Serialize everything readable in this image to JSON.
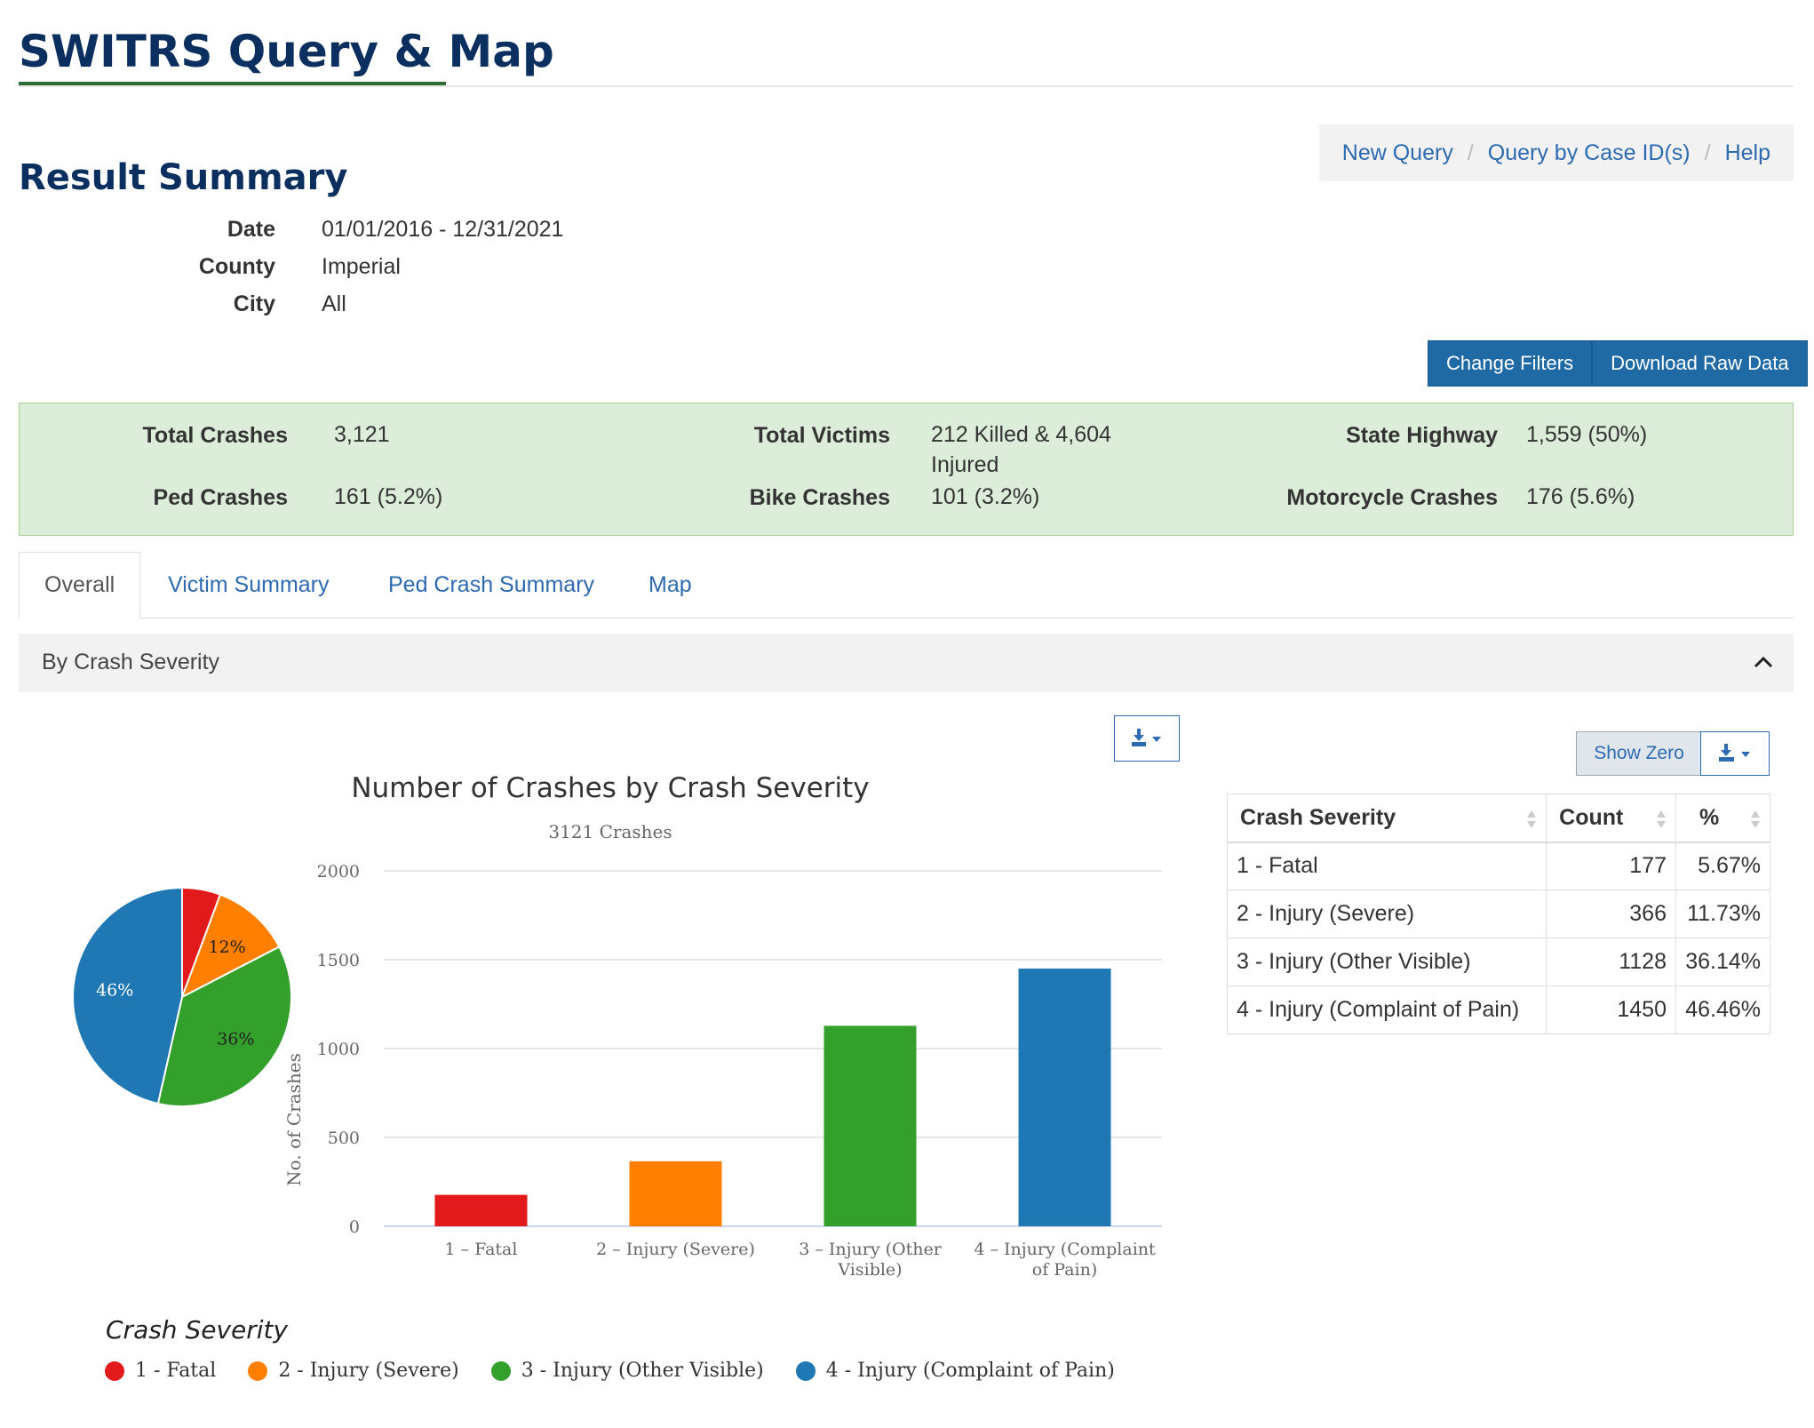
{
  "app": {
    "title": "SWITRS Query & Map"
  },
  "nav": {
    "links": [
      "New Query",
      "Query by Case ID(s)",
      "Help"
    ]
  },
  "result": {
    "title": "Result Summary",
    "filters": [
      {
        "label": "Date",
        "value": "01/01/2016 - 12/31/2021"
      },
      {
        "label": "County",
        "value": "Imperial"
      },
      {
        "label": "City",
        "value": "All"
      }
    ]
  },
  "buttons": {
    "change_filters": "Change Filters",
    "download_raw": "Download Raw Data"
  },
  "summary": {
    "total_crashes_label": "Total Crashes",
    "total_crashes_value": "3,121",
    "ped_crashes_label": "Ped Crashes",
    "ped_crashes_value": "161 (5.2%)",
    "total_victims_label": "Total Victims",
    "total_victims_value": "212 Killed & 4,604 Injured",
    "bike_crashes_label": "Bike Crashes",
    "bike_crashes_value": "101 (3.2%)",
    "state_highway_label": "State Highway",
    "state_highway_value": "1,559 (50%)",
    "motorcycle_label": "Motorcycle Crashes",
    "motorcycle_value": "176 (5.6%)"
  },
  "tabs": [
    {
      "label": "Overall",
      "active": true
    },
    {
      "label": "Victim Summary",
      "active": false
    },
    {
      "label": "Ped Crash Summary",
      "active": false
    },
    {
      "label": "Map",
      "active": false
    }
  ],
  "panel": {
    "title": "By Crash Severity"
  },
  "table": {
    "show_zero": "Show Zero",
    "headers": [
      "Crash Severity",
      "Count",
      "%"
    ],
    "rows": [
      [
        "1 - Fatal",
        "177",
        "5.67%"
      ],
      [
        "2 - Injury (Severe)",
        "366",
        "11.73%"
      ],
      [
        "3 - Injury (Other Visible)",
        "1128",
        "36.14%"
      ],
      [
        "4 - Injury (Complaint of Pain)",
        "1450",
        "46.46%"
      ]
    ]
  },
  "chart_data": [
    {
      "type": "bar",
      "title": "Number of Crashes by Crash Severity",
      "subtitle": "3121 Crashes",
      "xlabel": "",
      "ylabel": "No. of Crashes",
      "ylim": [
        0,
        2000
      ],
      "yticks": [
        0,
        500,
        1000,
        1500,
        2000
      ],
      "grid": true,
      "categories": [
        "1 - Fatal",
        "2 - Injury (Severe)",
        "3 - Injury (Other Visible)",
        "4 - Injury (Complaint of Pain)"
      ],
      "values": [
        177,
        366,
        1128,
        1450
      ],
      "colors": [
        "#e31a1c",
        "#ff7f00",
        "#33a02c",
        "#1f78b4"
      ]
    },
    {
      "type": "pie",
      "categories": [
        "1 - Fatal",
        "2 - Injury (Severe)",
        "3 - Injury (Other Visible)",
        "4 - Injury (Complaint of Pain)"
      ],
      "values": [
        177,
        366,
        1128,
        1450
      ],
      "labels": [
        "",
        "12%",
        "36%",
        "46%"
      ],
      "colors": [
        "#e31a1c",
        "#ff7f00",
        "#33a02c",
        "#1f78b4"
      ]
    }
  ],
  "legend": {
    "title": "Crash Severity",
    "items": [
      {
        "label": "1 - Fatal",
        "color": "#e31a1c"
      },
      {
        "label": "2 - Injury (Severe)",
        "color": "#ff7f00"
      },
      {
        "label": "3 - Injury (Other Visible)",
        "color": "#33a02c"
      },
      {
        "label": "4 - Injury (Complaint of Pain)",
        "color": "#1f78b4"
      }
    ]
  },
  "icons": {
    "export": "download-icon",
    "collapse": "chevron-up-icon",
    "sort": "sort-icon"
  }
}
